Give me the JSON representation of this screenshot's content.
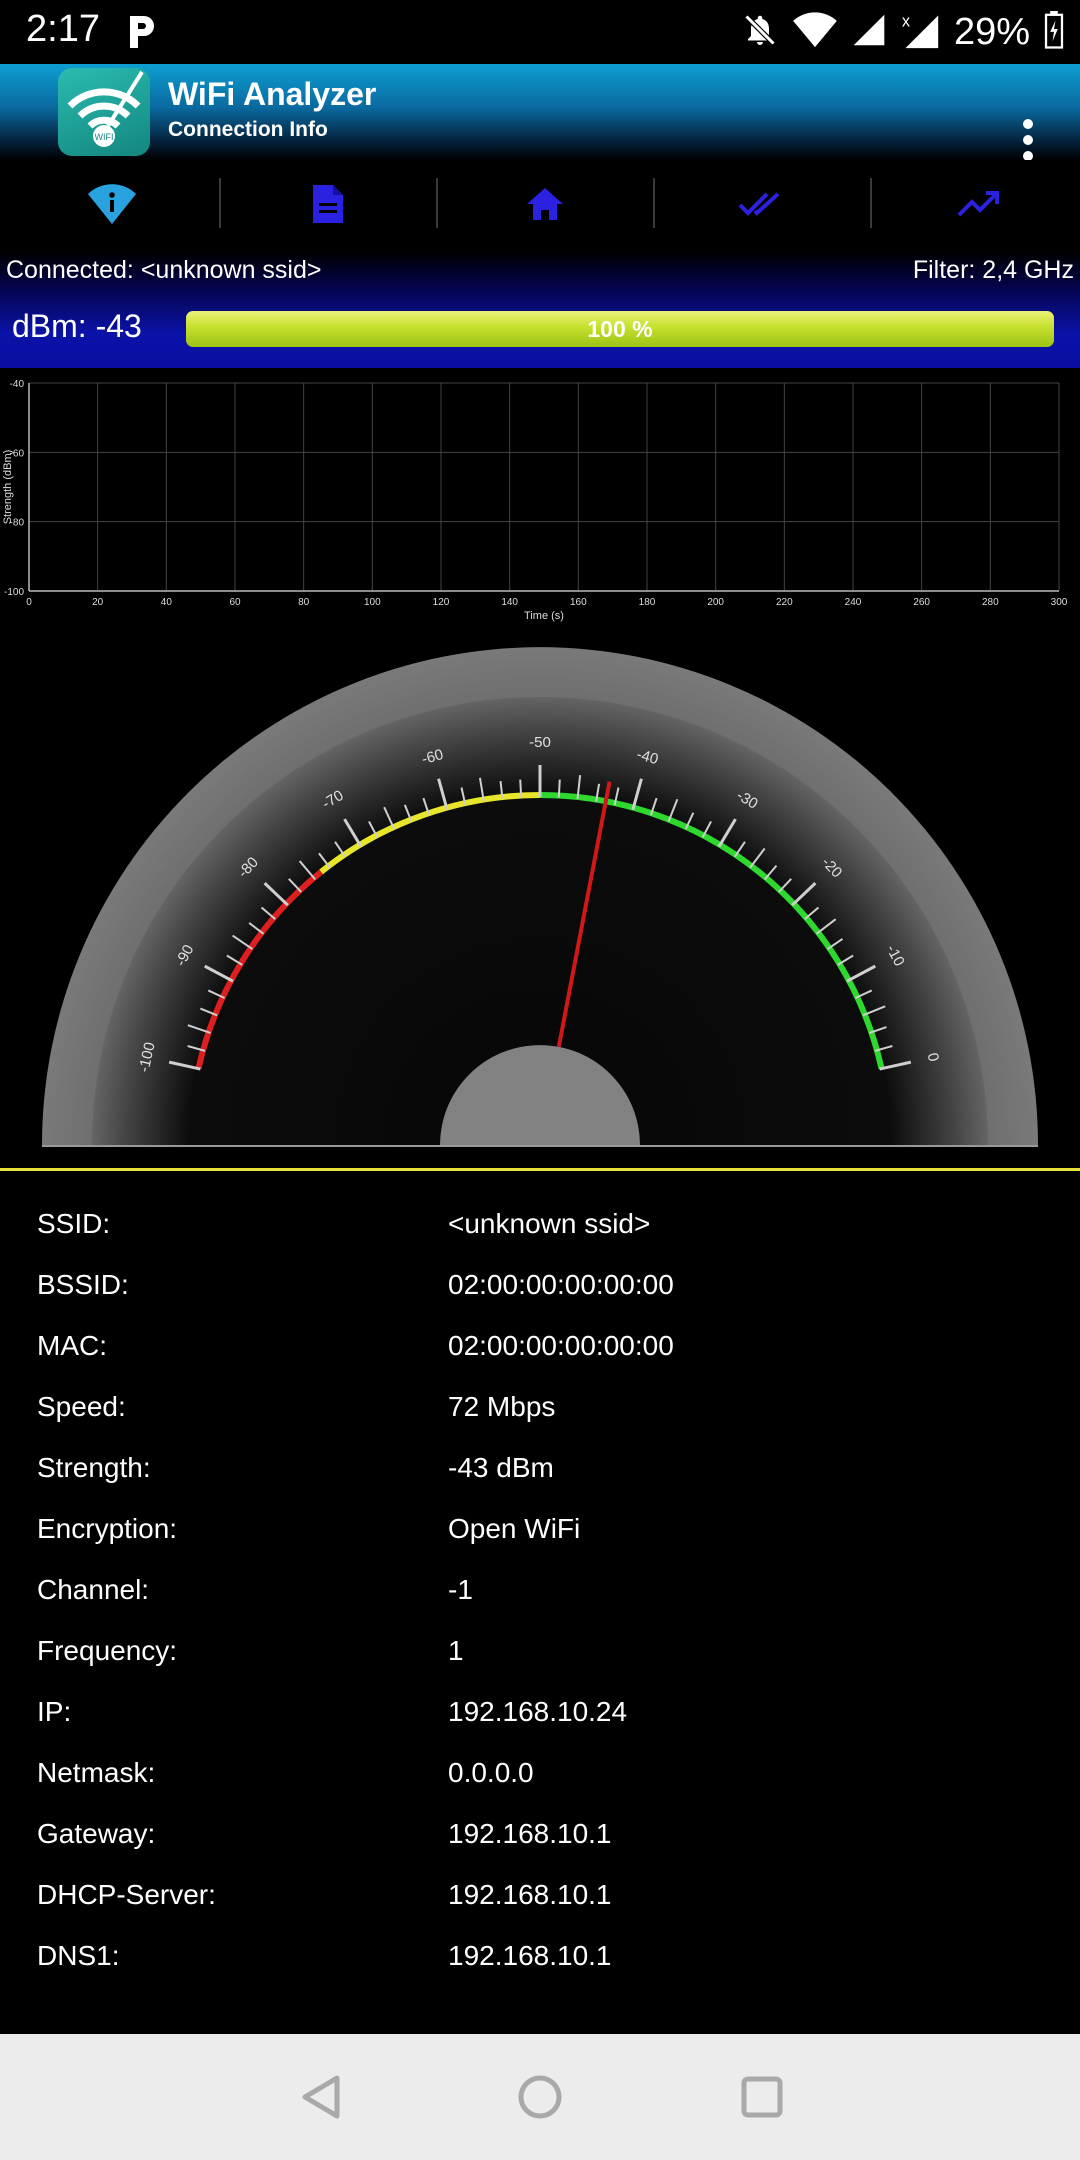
{
  "status_bar": {
    "time": "2:17",
    "battery_percent": "29%",
    "icons": [
      "p-icon",
      "bell-off-icon",
      "wifi-icon",
      "signal-icon",
      "signal-x-icon",
      "battery-icon"
    ]
  },
  "app_bar": {
    "title": "WiFi Analyzer",
    "subtitle": "Connection Info",
    "logo_icon": "wifi-analyzer-logo-icon",
    "menu_icon": "more-vert-icon"
  },
  "tabs": [
    {
      "name": "info",
      "icon": "info-wifi-icon",
      "color": "#29a3e0",
      "selected": true
    },
    {
      "name": "document",
      "icon": "document-icon",
      "color": "#2a22e0"
    },
    {
      "name": "home",
      "icon": "home-icon",
      "color": "#2a22e0"
    },
    {
      "name": "check",
      "icon": "double-check-icon",
      "color": "#2a22e0"
    },
    {
      "name": "trend",
      "icon": "trending-up-icon",
      "color": "#2a22e0"
    }
  ],
  "connection": {
    "connected_text": "Connected: <unknown ssid>",
    "filter_text": "Filter: 2,4 GHz",
    "dbm_text": "dBm: -43",
    "signal_percent": 100,
    "signal_percent_label": "100 %"
  },
  "chart_data": {
    "type": "line",
    "xlabel": "Time (s)",
    "ylabel": "Strength (dBm)",
    "xlim": [
      0,
      300
    ],
    "ylim": [
      -100,
      -40
    ],
    "x_ticks": [
      "0",
      "20",
      "40",
      "60",
      "80",
      "100",
      "120",
      "140",
      "160",
      "180",
      "200",
      "220",
      "240",
      "260",
      "280",
      "300"
    ],
    "y_ticks": [
      "-40",
      "-60",
      "-80",
      "-100"
    ],
    "grid": true,
    "series": []
  },
  "gauge": {
    "min": -100,
    "max": 0,
    "value": -43,
    "tick_labels": [
      "-100",
      "-90",
      "-80",
      "-70",
      "-60",
      "-50",
      "-40",
      "-30",
      "-20",
      "-10",
      "0"
    ],
    "zones": [
      {
        "from": -100,
        "to": -75,
        "color": "#dd1f1f"
      },
      {
        "from": -75,
        "to": -50,
        "color": "#e7e62a"
      },
      {
        "from": -50,
        "to": 0,
        "color": "#2ed82e"
      }
    ],
    "needle_color": "#d01818"
  },
  "info": [
    {
      "key": "SSID:",
      "value": "<unknown ssid>"
    },
    {
      "key": "BSSID:",
      "value": "02:00:00:00:00:00"
    },
    {
      "key": "MAC:",
      "value": "02:00:00:00:00:00"
    },
    {
      "key": "Speed:",
      "value": "72 Mbps"
    },
    {
      "key": "Strength:",
      "value": "-43 dBm"
    },
    {
      "key": "Encryption:",
      "value": "Open WiFi"
    },
    {
      "key": "Channel:",
      "value": "-1"
    },
    {
      "key": "Frequency:",
      "value": "1"
    },
    {
      "key": "IP:",
      "value": "192.168.10.24"
    },
    {
      "key": "Netmask:",
      "value": "0.0.0.0"
    },
    {
      "key": "Gateway:",
      "value": "192.168.10.1"
    },
    {
      "key": "DHCP-Server:",
      "value": "192.168.10.1"
    },
    {
      "key": "DNS1:",
      "value": "192.168.10.1"
    }
  ],
  "nav_bar": {
    "buttons": [
      "back-icon",
      "home-circle-icon",
      "recents-icon"
    ]
  }
}
